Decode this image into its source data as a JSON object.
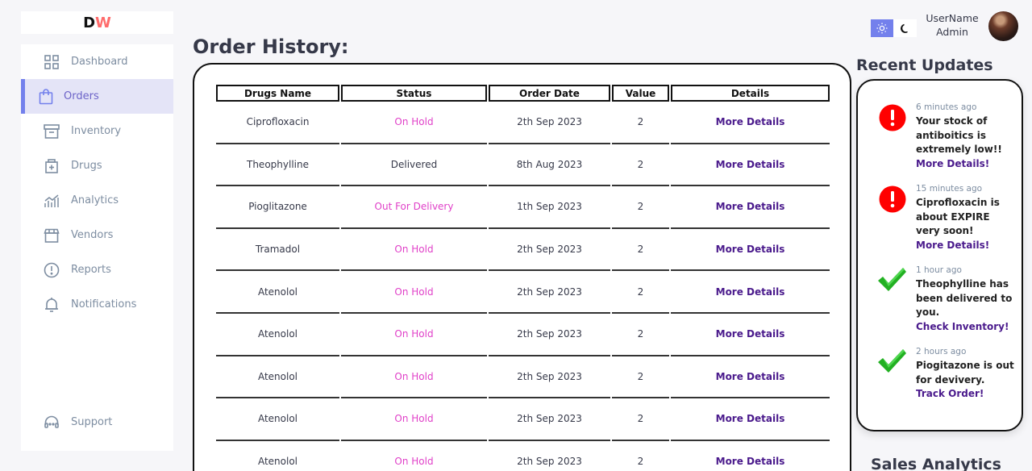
{
  "logo": {
    "first": "D",
    "second": "W"
  },
  "sidebar": {
    "items": [
      {
        "label": "Dashboard",
        "icon": "grid-icon"
      },
      {
        "label": "Orders",
        "icon": "bag-icon"
      },
      {
        "label": "Inventory",
        "icon": "archive-icon"
      },
      {
        "label": "Drugs",
        "icon": "medkit-icon"
      },
      {
        "label": "Analytics",
        "icon": "chart-icon"
      },
      {
        "label": "Vendors",
        "icon": "store-icon"
      },
      {
        "label": "Reports",
        "icon": "report-icon"
      },
      {
        "label": "Notifications",
        "icon": "bell-icon"
      }
    ],
    "support": {
      "label": "Support",
      "icon": "headset-icon"
    }
  },
  "header": {
    "title": "Order History:",
    "user_name": "UserName",
    "user_role": "Admin"
  },
  "orders": {
    "columns": [
      "Drugs Name",
      "Status",
      "Order Date",
      "Value",
      "Details"
    ],
    "rows": [
      {
        "name": "Ciprofloxacin",
        "status": "On Hold",
        "date": "2th Sep 2023",
        "value": "2",
        "details": "More Details"
      },
      {
        "name": "Theophylline",
        "status": "Delivered",
        "date": "8th Aug 2023",
        "value": "2",
        "details": "More Details"
      },
      {
        "name": "Pioglitazone",
        "status": "Out For Delivery",
        "date": "1th Sep 2023",
        "value": "2",
        "details": "More Details"
      },
      {
        "name": "Tramadol",
        "status": "On Hold",
        "date": "2th Sep 2023",
        "value": "2",
        "details": "More Details"
      },
      {
        "name": "Atenolol",
        "status": "On Hold",
        "date": "2th Sep 2023",
        "value": "2",
        "details": "More Details"
      },
      {
        "name": "Atenolol",
        "status": "On Hold",
        "date": "2th Sep 2023",
        "value": "2",
        "details": "More Details"
      },
      {
        "name": "Atenolol",
        "status": "On Hold",
        "date": "2th Sep 2023",
        "value": "2",
        "details": "More Details"
      },
      {
        "name": "Atenolol",
        "status": "On Hold",
        "date": "2th Sep 2023",
        "value": "2",
        "details": "More Details"
      },
      {
        "name": "Atenolol",
        "status": "On Hold",
        "date": "2th Sep 2023",
        "value": "2",
        "details": "More Details"
      }
    ]
  },
  "updates": {
    "title": "Recent Updates",
    "items": [
      {
        "type": "alert",
        "time": "6 minutes ago",
        "message": "Your stock of antiboitics is extremely low!!",
        "link": "More Details!"
      },
      {
        "type": "alert",
        "time": "15 minutes ago",
        "message": "Ciprofloxacin is about EXPIRE very soon!",
        "link": "More Details!"
      },
      {
        "type": "check",
        "time": "1 hour ago",
        "message": "Theophylline has been delivered to you.",
        "link": "Check Inventory!"
      },
      {
        "type": "check",
        "time": "2 hours ago",
        "message": "Piogitazone is out for devivery.",
        "link": "Track Order!"
      }
    ]
  },
  "sales": {
    "title": "Sales Analytics"
  },
  "colors": {
    "accent": "#7380ec",
    "alert": "#ff0000",
    "check": "#22b022",
    "status_pink": "#e040c8",
    "link": "#4a1a8c"
  }
}
